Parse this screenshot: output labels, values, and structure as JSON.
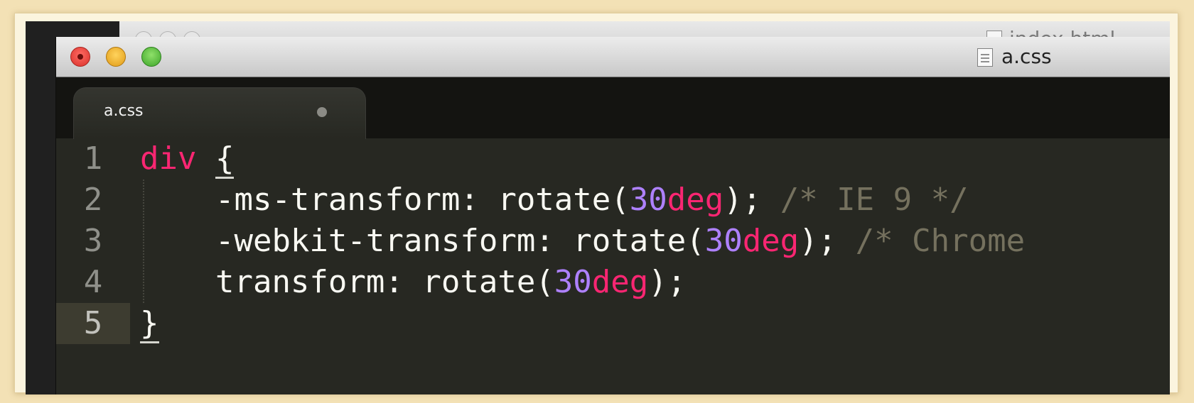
{
  "background_window": {
    "title": "index.html"
  },
  "window": {
    "title": "a.css"
  },
  "tabs": [
    {
      "label": "a.css",
      "dirty": true
    }
  ],
  "gutter": [
    "1",
    "2",
    "3",
    "4",
    "5"
  ],
  "code": {
    "l1": {
      "selector": "div",
      "brace": "{"
    },
    "l2": {
      "indent": "    ",
      "prop": "-ms-transform: rotate(",
      "num": "30",
      "unit": "deg",
      "close": ");",
      "comment": " /* IE 9 */"
    },
    "l3": {
      "indent": "    ",
      "prop": "-webkit-transform: rotate(",
      "num": "30",
      "unit": "deg",
      "close": ");",
      "comment": " /* Chrome"
    },
    "l4": {
      "indent": "    ",
      "prop": "transform: rotate(",
      "num": "30",
      "unit": "deg",
      "close": ");"
    },
    "l5": {
      "brace": "}"
    }
  },
  "colors": {
    "background": "#272822",
    "keyword": "#f92672",
    "number": "#ae81ff",
    "comment": "#75715e",
    "text": "#f8f8f2"
  }
}
